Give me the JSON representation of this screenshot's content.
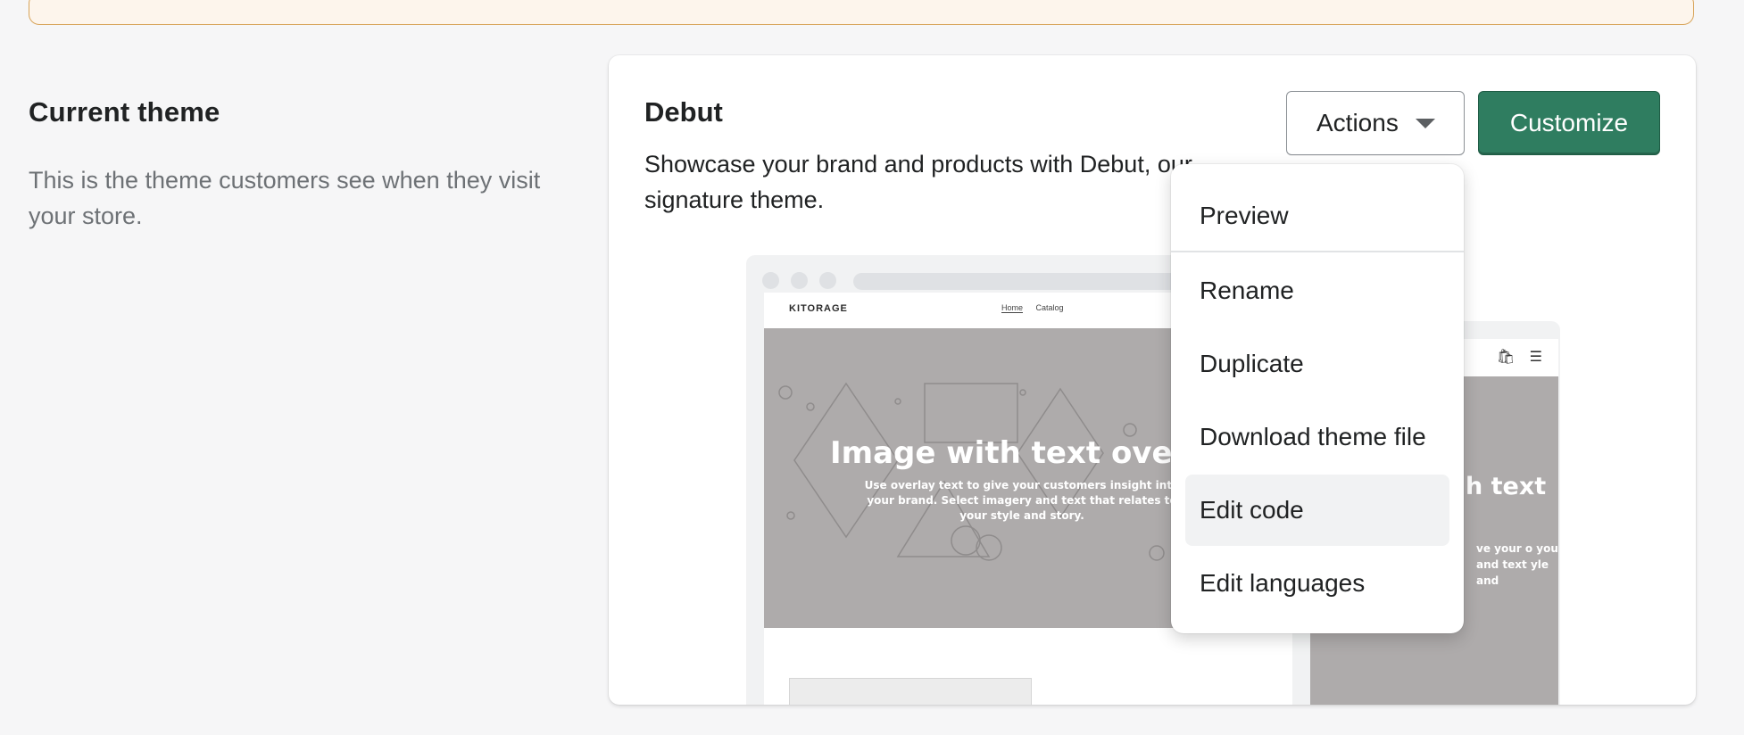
{
  "section": {
    "title": "Current theme",
    "description": "This is the theme customers see when they visit your store."
  },
  "theme": {
    "name": "Debut",
    "description": "Showcase your brand and products with Debut, our signature theme.",
    "actions_label": "Actions",
    "customize_label": "Customize"
  },
  "preview": {
    "brand": "KITORAGE",
    "nav": [
      "Home",
      "Catalog"
    ],
    "hero_title": "Image with text overlay",
    "hero_subtitle": "Use overlay text to give your customers insight into your brand. Select imagery and text that relates to your style and story.",
    "mobile_title": "h text",
    "mobile_title_line2": "y",
    "mobile_subtitle": "ve your o your and text yle and"
  },
  "dropdown": {
    "items": [
      "Preview",
      "Rename",
      "Duplicate",
      "Download theme file",
      "Edit code",
      "Edit languages"
    ]
  },
  "colors": {
    "primary_button": "#2f7d60",
    "banner_border": "#d8a45a",
    "hero_bg": "#aeabab"
  }
}
